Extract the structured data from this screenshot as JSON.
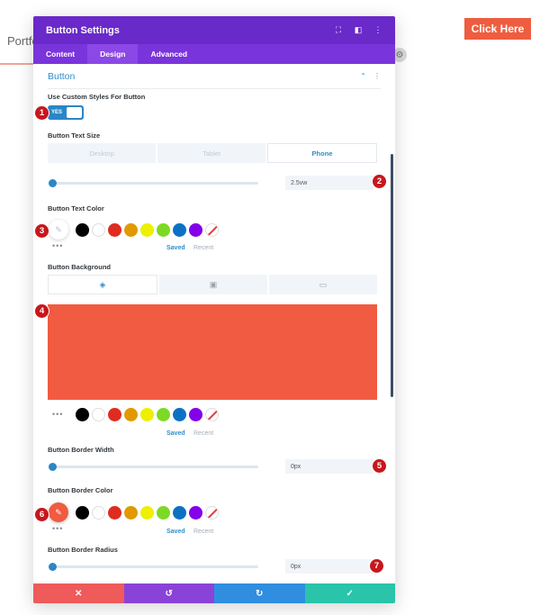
{
  "background": {
    "nav_text": "Portfo",
    "cta_button": "Click Here"
  },
  "modal": {
    "title": "Button Settings",
    "tabs": [
      {
        "label": "Content"
      },
      {
        "label": "Design"
      },
      {
        "label": "Advanced"
      }
    ],
    "section_title": "Button",
    "fields": {
      "custom_styles_label": "Use Custom Styles For Button",
      "toggle_value": "YES",
      "text_size_label": "Button Text Size",
      "devices": [
        "Desktop",
        "Tablet",
        "Phone"
      ],
      "text_size_value": "2.5vw",
      "text_color_label": "Button Text Color",
      "background_label": "Button Background",
      "border_width_label": "Button Border Width",
      "border_width_value": "0px",
      "border_color_label": "Button Border Color",
      "border_radius_label": "Button Border Radius",
      "border_radius_value": "0px"
    },
    "palette": {
      "saved": "Saved",
      "recent": "Recent",
      "dots": "•••",
      "colors": [
        "#000000",
        "#ffffff",
        "#e02b20",
        "#e09900",
        "#edf000",
        "#7cda24",
        "#0c71c3",
        "#8300e9"
      ]
    },
    "preview_color": "#f15b41",
    "footer_colors": [
      "#ef5a5a",
      "#8a43d8",
      "#2f8ee0",
      "#29c4a9"
    ]
  },
  "badges": [
    "1",
    "2",
    "3",
    "4",
    "5",
    "6",
    "7"
  ]
}
